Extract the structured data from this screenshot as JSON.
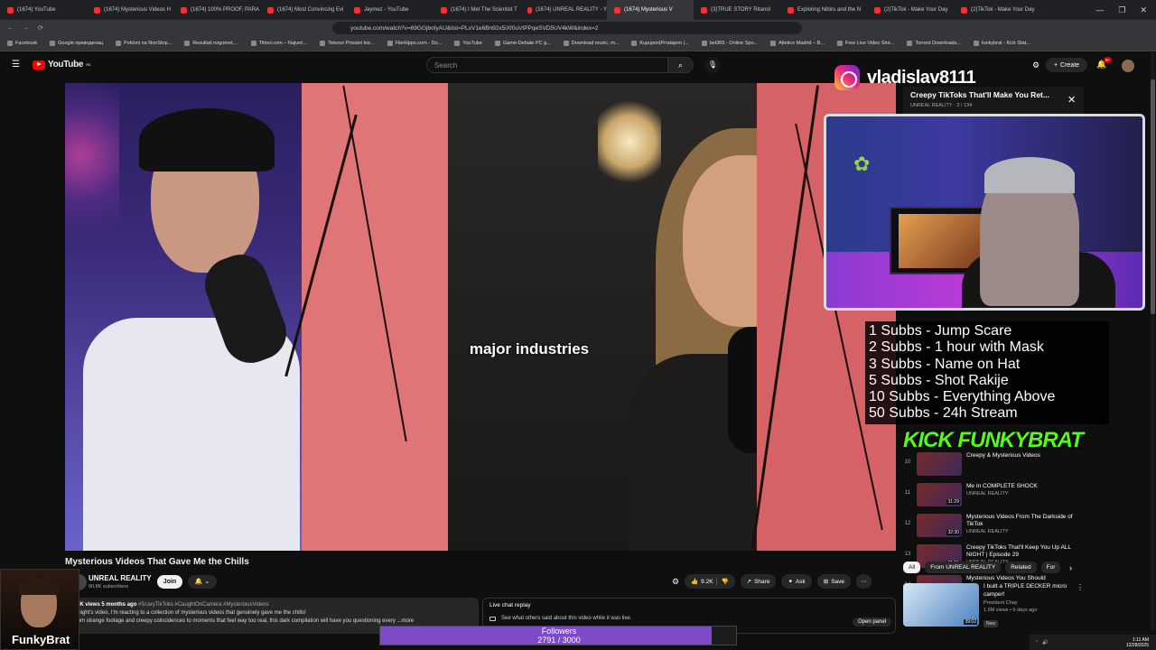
{
  "browser": {
    "tabs": [
      {
        "label": "(1674) YouTube",
        "active": false
      },
      {
        "label": "(1674) Mysterious Videos H",
        "active": false
      },
      {
        "label": "(1674) 100% PROOF, PARA",
        "active": false
      },
      {
        "label": "(1674) Most Convincing Evi",
        "active": false
      },
      {
        "label": "Jaymez - YouTube",
        "active": false
      },
      {
        "label": "(1674) I Met The Scientist T",
        "active": false
      },
      {
        "label": "(1674) UNREAL REALITY - Y",
        "active": false
      },
      {
        "label": "(1674) Mysterious V",
        "active": true
      },
      {
        "label": "(3)TRUE STORY Ritanol",
        "active": false
      },
      {
        "label": "Exploring Nibiru and the N",
        "active": false
      },
      {
        "label": "(2)TikTok - Make Your Day",
        "active": false
      },
      {
        "label": "(2)TikTok - Make Your Day",
        "active": false
      }
    ],
    "url": "youtube.com/watch?v=69GGjboIyAU&list=PLxV1e6Bn92x5iXf0uVtPPqeSVD5UV4kW&index=2",
    "bookmarks": [
      "Facebook",
      "Google преводилац",
      "Pokloni na NonStop...",
      "Rezultati nogomet,...",
      "Titlovi.com – Najveć...",
      "Telenor Privatni kor...",
      "FileHippo.com - Do...",
      "YouTube",
      "Game-Debate PC g...",
      "Download music, m...",
      "Kupujem|Prodajem |...",
      "bet365 - Online Spo...",
      "Atletico Madrid – B...",
      "Free Live Video Stre...",
      "Torrent Downloads...",
      "funkybrat - Kick Stat..."
    ]
  },
  "youtube": {
    "logo": "YouTube",
    "logo_region": "RS",
    "search_placeholder": "Search",
    "create_label": "Create",
    "notif_count": "9+"
  },
  "video": {
    "caption": "major industries",
    "corner_letter": "C",
    "title": "Mysterious Videos That Gave Me the Chills",
    "channel": "UNREAL REALITY",
    "subscribers": "90.8K subscribers",
    "join_label": "Join",
    "likes": "9.2K",
    "share_label": "Share",
    "ask_label": "Ask",
    "save_label": "Save",
    "desc_stats": "1.8K views  5 months ago",
    "desc_tags": "#ScaryTikToks #CaughtOnCamera #MysteriousVideos",
    "desc_line1": "Tonight's video, I'm reacting to a collection of mysterious videos that genuinely gave me the chills!",
    "desc_line2": "From strange footage and creepy coincidences to moments that feel way too real, this dark compilation will have you questioning every ...more",
    "live_chat_label": "Live chat replay",
    "live_chat_sub": "See what others said about this video while it was live.",
    "open_panel": "Open panel"
  },
  "overlay": {
    "instagram_handle": "vladislav8111",
    "subs_goals": [
      "1 Subbs - Jump Scare",
      "2 Subbs - 1 hour with Mask",
      "3 Subbs - Name on Hat",
      "5 Subbs - Shot Rakije",
      "10 Subbs - Everything Above",
      "50 Subbs - 24h Stream"
    ],
    "kick_label": "KICK FUNKYBRAT",
    "followers_label": "Followers",
    "followers_count": "2791 / 3000",
    "followers_progress": 0.9303,
    "cam_name": "FunkyBrat"
  },
  "playlist": {
    "title": "Creepy TikToks That'll Make You Ret...",
    "sub": "UNREAL REALITY · 2 / 134",
    "items": [
      {
        "num": "10",
        "title": "Creepy & Mysterious Videos",
        "channel": "",
        "dur": ""
      },
      {
        "num": "11",
        "title": "Me In COMPLETE SHOCK",
        "channel": "UNREAL REALITY",
        "dur": "31:29"
      },
      {
        "num": "12",
        "title": "Mysterious Videos From The Darkside of TikTok",
        "channel": "UNREAL REALITY",
        "dur": "32:30"
      },
      {
        "num": "13",
        "title": "Creepy TikToks That'll Keep You Up ALL NIGHT | Episode 29",
        "channel": "UNREAL REALITY",
        "dur": "31:51"
      },
      {
        "num": "14",
        "title": "Mysterious Videos You Should",
        "channel": "",
        "dur": ""
      }
    ]
  },
  "related": {
    "chips": [
      "All",
      "From UNREAL REALITY",
      "Related",
      "For"
    ],
    "rec_title": "I built a TRIPLE DECKER micro camper!",
    "rec_channel": "President Chay",
    "rec_stats": "1.6M views • 6 days ago",
    "rec_badge": "New",
    "rec_dur": "39:02"
  },
  "system": {
    "time": "1:11 AM",
    "date": "12/28/2025"
  }
}
